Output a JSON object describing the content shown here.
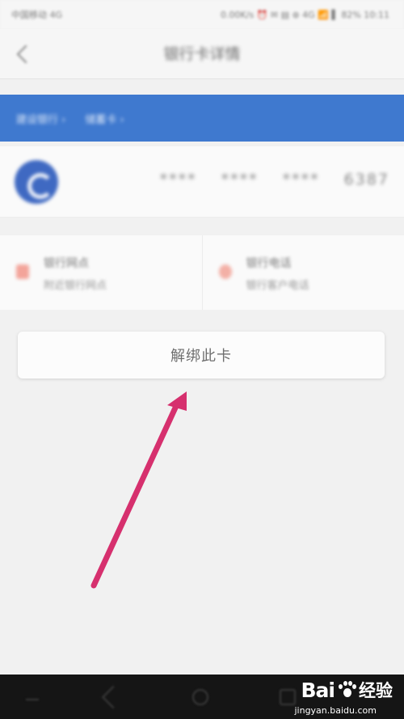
{
  "status_bar": {
    "carrier": "中国移动 4G",
    "indicators": "0.00K/s ⏰ ✉ ▤ ⊛ 4G 📶 ▌ 82% 10:11"
  },
  "nav": {
    "title": "银行卡详情"
  },
  "card_strip": {
    "label_1": "建设银行 ›",
    "label_2": "储蓄卡 ›"
  },
  "card": {
    "number_groups": [
      "****",
      "****",
      "****",
      "6387"
    ]
  },
  "options": [
    {
      "title": "银行网点",
      "subtitle": "附近银行网点"
    },
    {
      "title": "银行电话",
      "subtitle": "银行客户电话"
    }
  ],
  "unbind_button": {
    "label": "解绑此卡"
  },
  "annotation": {
    "arrow_color": "#d6306e"
  },
  "watermark": {
    "brand": "Bai",
    "brand_cn": "经验",
    "url": "jingyan.baidu.com"
  }
}
